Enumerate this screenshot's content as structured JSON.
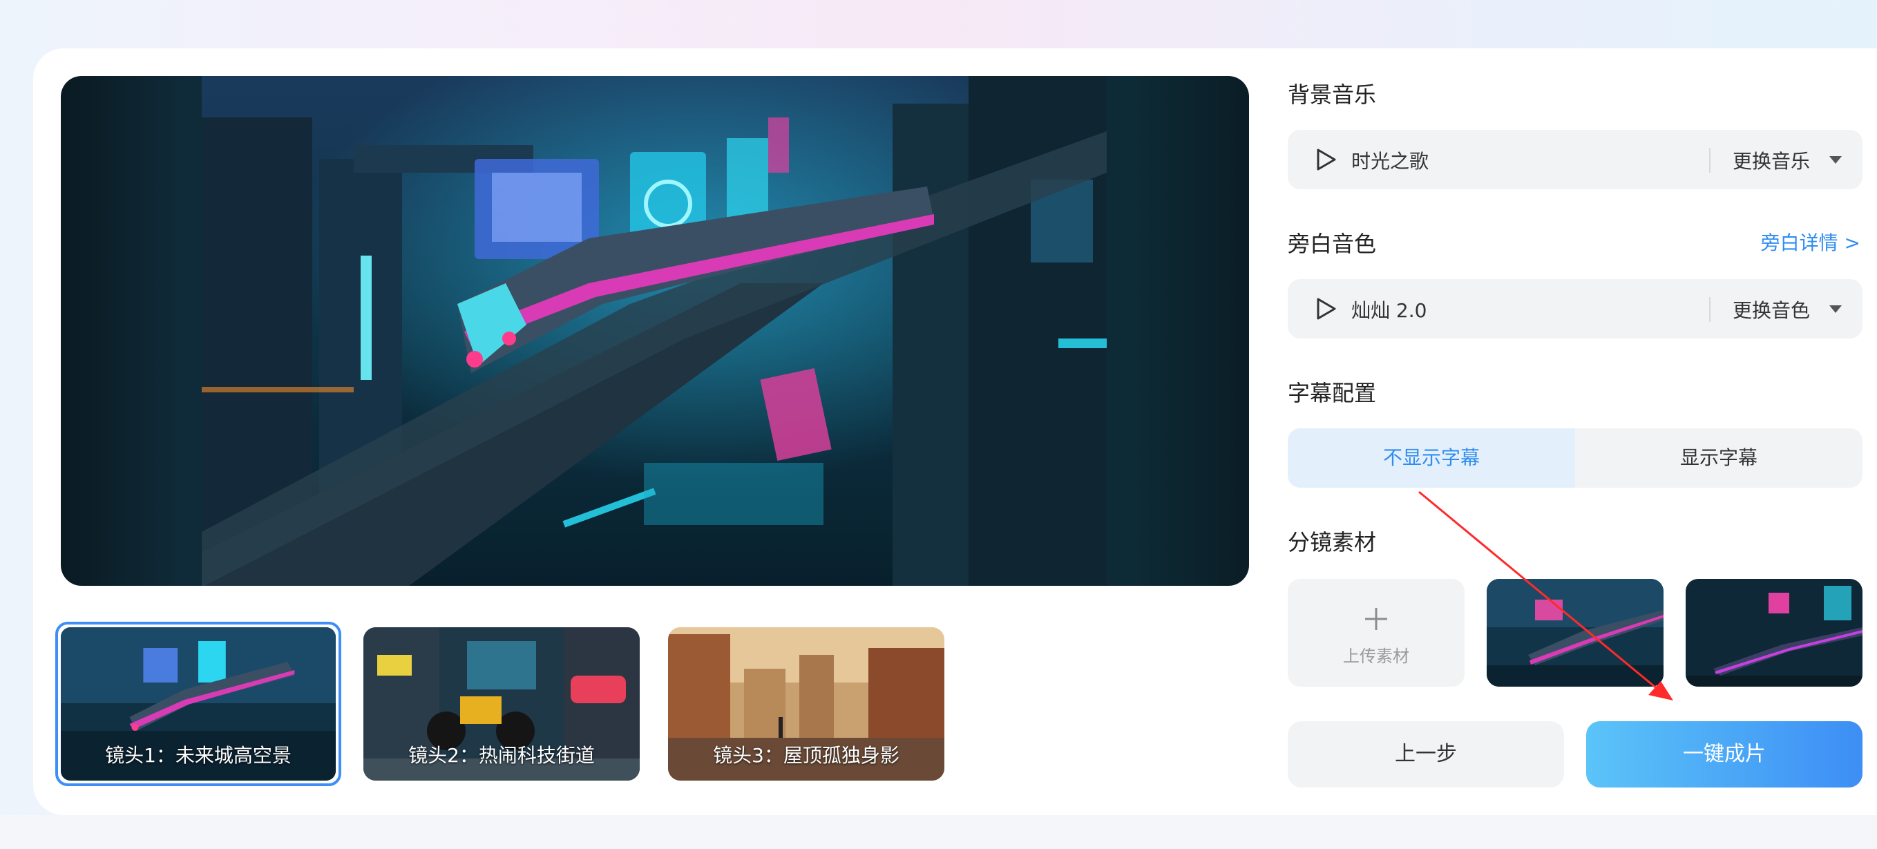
{
  "preview": {
    "alt": ""
  },
  "shots": [
    {
      "label": "镜头1：未来城高空景",
      "selected": true
    },
    {
      "label": "镜头2：热闹科技街道",
      "selected": false
    },
    {
      "label": "镜头3：屋顶孤独身影",
      "selected": false
    }
  ],
  "music": {
    "title": "背景音乐",
    "value": "时光之歌",
    "change_label": "更换音乐"
  },
  "voice": {
    "title": "旁白音色",
    "detail_link": "旁白详情 >",
    "value": "灿灿 2.0",
    "change_label": "更换音色"
  },
  "subtitle": {
    "title": "字幕配置",
    "options": [
      "不显示字幕",
      "显示字幕"
    ],
    "selected": "不显示字幕"
  },
  "materials": {
    "title": "分镜素材",
    "upload_label": "上传素材"
  },
  "actions": {
    "prev_label": "上一步",
    "make_label": "一键成片"
  },
  "colors": {
    "accent": "#2f8cf0",
    "selected_border": "#3d8ef5",
    "annotation_arrow": "#ff2a2a"
  }
}
